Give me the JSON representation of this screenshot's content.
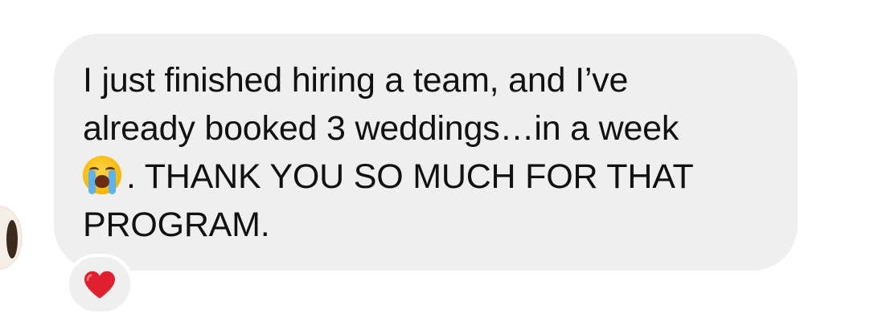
{
  "message": {
    "lines": [
      "I just finished hiring a team, and I’ve",
      "already booked 3 weddings…in a week",
      ". THANK YOU SO MUCH FOR THAT",
      "PROGRAM."
    ],
    "emoji": "loudly-crying-face"
  },
  "reaction": {
    "emoji": "red-heart",
    "color": "#e0202e"
  },
  "colors": {
    "bubble": "#efefef",
    "text": "#111111",
    "background": "#ffffff"
  }
}
